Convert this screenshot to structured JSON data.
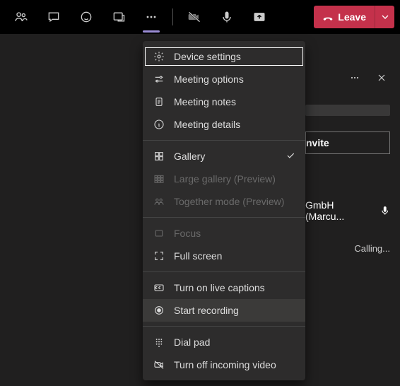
{
  "toolbar": {
    "leave_label": "Leave"
  },
  "menu": {
    "device_settings": "Device settings",
    "meeting_options": "Meeting options",
    "meeting_notes": "Meeting notes",
    "meeting_details": "Meeting details",
    "gallery": "Gallery",
    "large_gallery": "Large gallery (Preview)",
    "together_mode": "Together mode (Preview)",
    "focus": "Focus",
    "full_screen": "Full screen",
    "live_captions": "Turn on live captions",
    "start_recording": "Start recording",
    "dial_pad": "Dial pad",
    "turn_off_incoming": "Turn off incoming video"
  },
  "panel": {
    "invite": "nvite",
    "participant_name": "GmbH (Marcu...",
    "status": "Calling..."
  }
}
